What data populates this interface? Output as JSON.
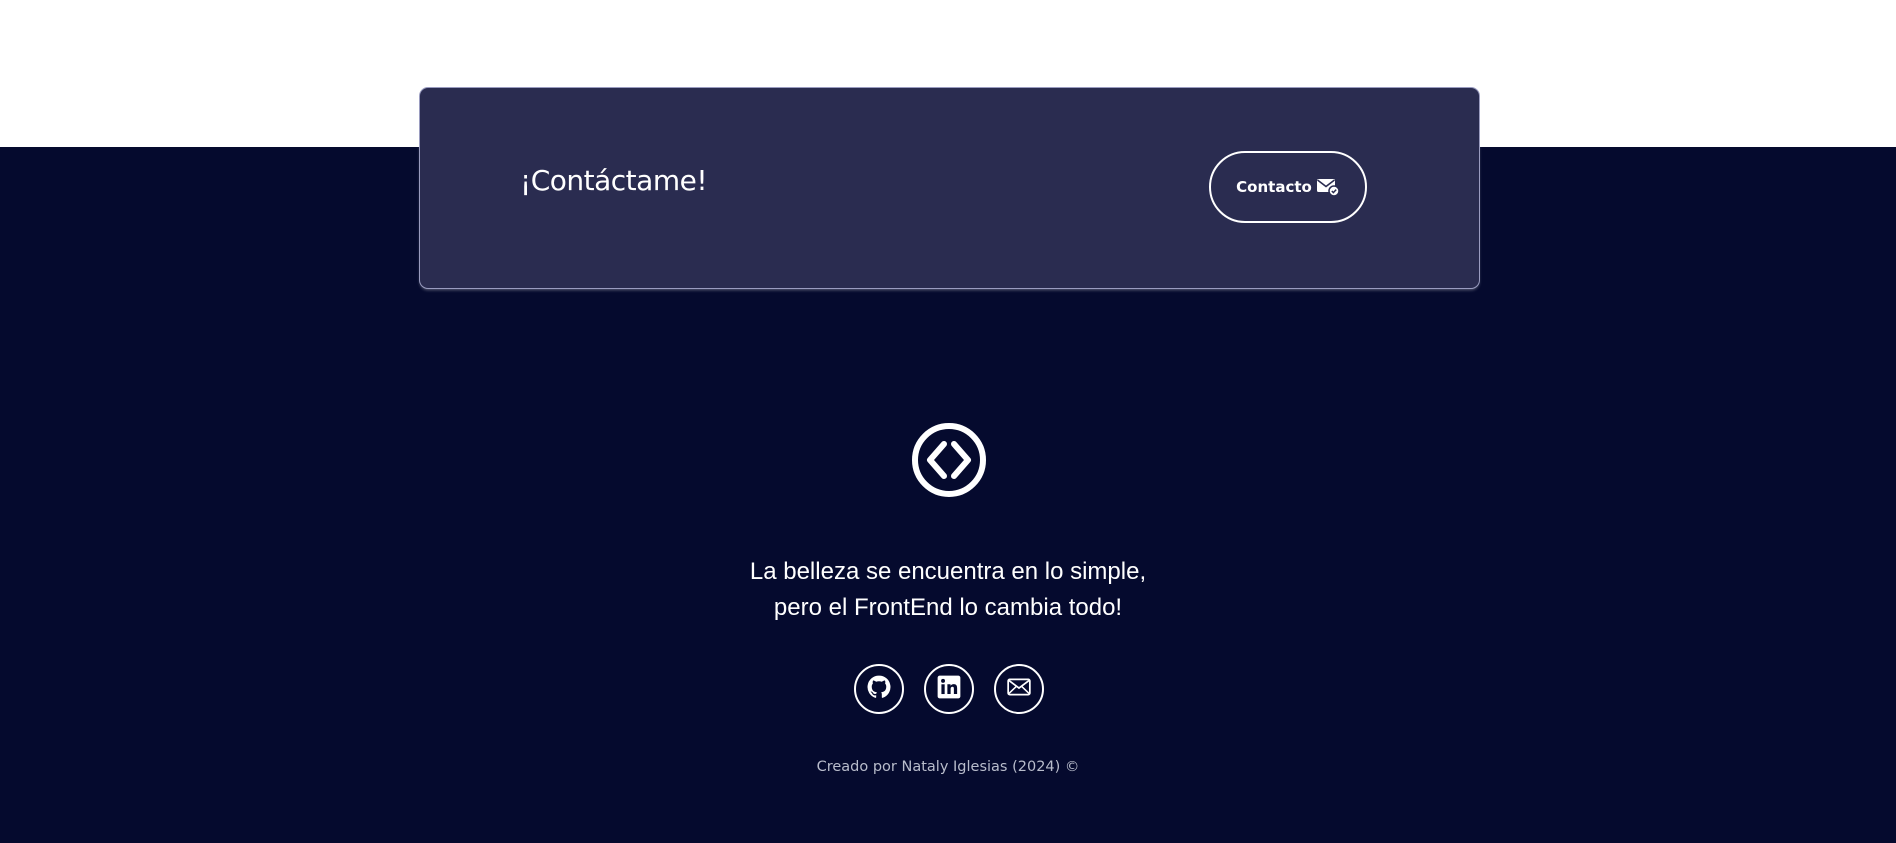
{
  "contact_card": {
    "title": "¡Contáctame!",
    "button_label": "Contacto",
    "button_icon": "mail-check-icon"
  },
  "footer": {
    "logo_icon": "code-brackets-icon",
    "tagline_line1": "La belleza se encuentra en lo simple,",
    "tagline_line2": "pero el FrontEnd lo cambia todo!",
    "socials": [
      {
        "icon": "github-icon"
      },
      {
        "icon": "linkedin-icon"
      },
      {
        "icon": "mail-icon"
      }
    ],
    "credit": "Creado por Nataly Iglesias (2024) ©"
  },
  "colors": {
    "page_bg": "#ffffff",
    "footer_bg": "#050a2e",
    "card_bg": "#2a2c50",
    "text": "#ffffff",
    "muted_text": "#b8bccb"
  }
}
